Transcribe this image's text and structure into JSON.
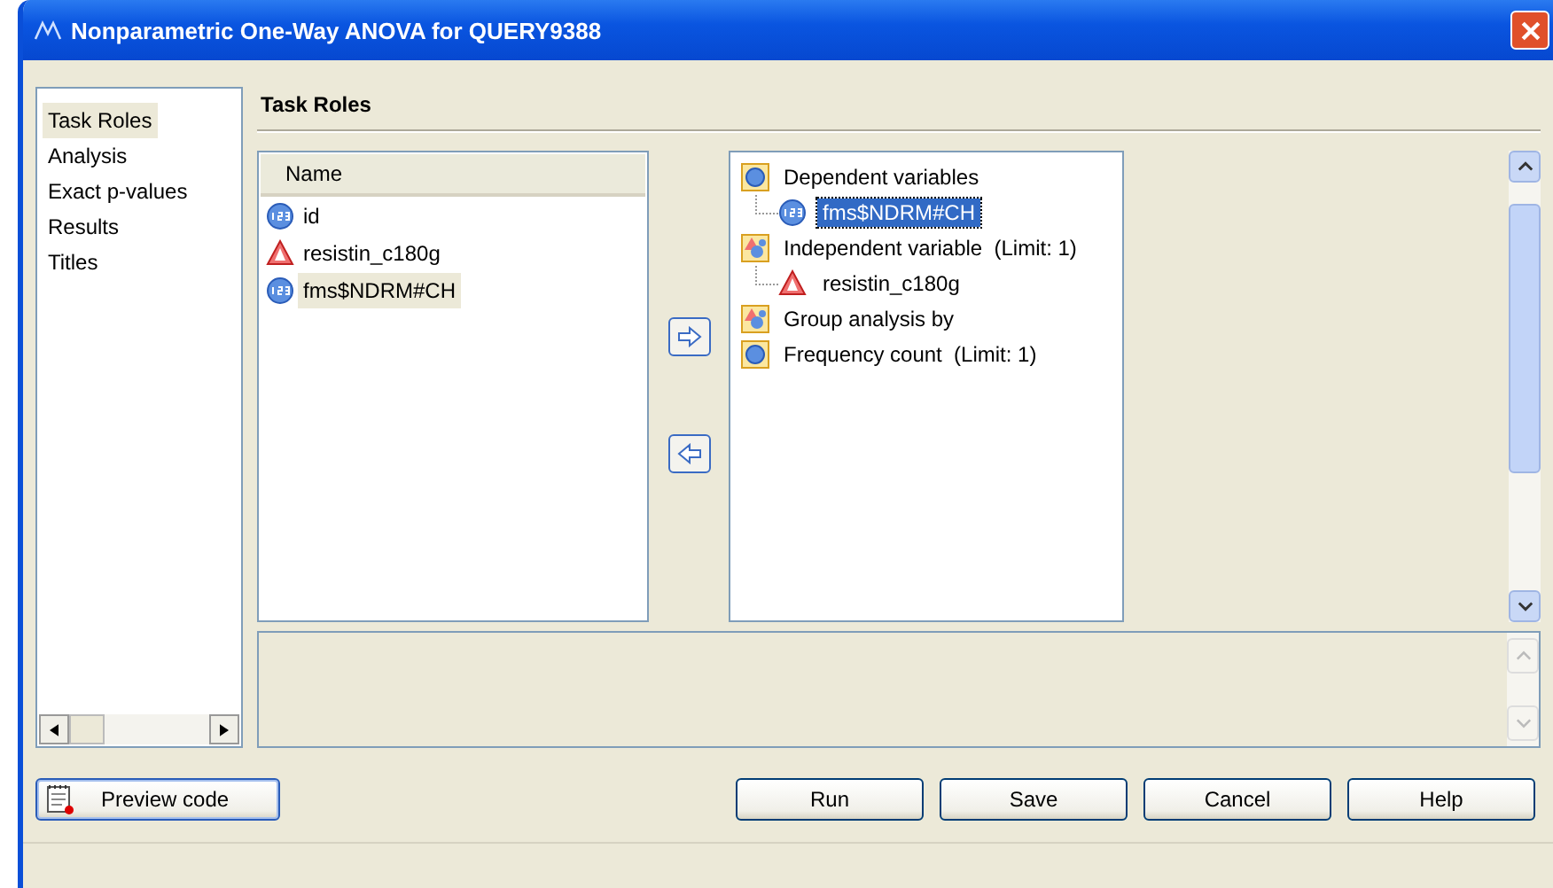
{
  "window": {
    "title": "Nonparametric One-Way ANOVA for QUERY9388"
  },
  "sidebar": {
    "items": [
      {
        "label": "Task Roles",
        "selected": true
      },
      {
        "label": "Analysis",
        "selected": false
      },
      {
        "label": "Exact p-values",
        "selected": false
      },
      {
        "label": "Results",
        "selected": false
      },
      {
        "label": "Titles",
        "selected": false
      }
    ]
  },
  "heading": "Task Roles",
  "variables": {
    "columns": [
      "Name"
    ],
    "rows": [
      {
        "name": "id",
        "kind": "numeric",
        "selected": false
      },
      {
        "name": "resistin_c180g",
        "kind": "character",
        "selected": false
      },
      {
        "name": "fms$NDRM#CH",
        "kind": "numeric",
        "selected": true
      }
    ]
  },
  "roles": [
    {
      "label": "Dependent variables",
      "kind": "numeric",
      "children": [
        {
          "name": "fms$NDRM#CH",
          "kind": "numeric",
          "selected": true
        }
      ]
    },
    {
      "label": "Independent variable  (Limit: 1)",
      "kind": "mixed",
      "children": [
        {
          "name": "resistin_c180g",
          "kind": "character",
          "selected": false
        }
      ]
    },
    {
      "label": "Group analysis by",
      "kind": "mixed"
    },
    {
      "label": "Frequency count  (Limit: 1)",
      "kind": "numeric"
    }
  ],
  "preview_button": "Preview code",
  "buttons": [
    "Run",
    "Save",
    "Cancel",
    "Help"
  ]
}
